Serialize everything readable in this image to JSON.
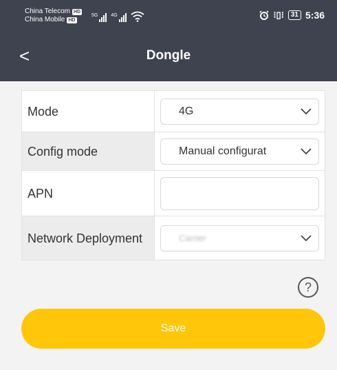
{
  "status_bar": {
    "carrier1": "China Telecom",
    "carrier2": "China Mobile",
    "hd_badge": "HD",
    "net1": "5G",
    "net2": "4G",
    "battery": "31",
    "time": "5:36"
  },
  "header": {
    "back_glyph": "<",
    "title": "Dongle"
  },
  "form": {
    "rows": [
      {
        "label": "Mode",
        "value": "4G"
      },
      {
        "label": "Config mode",
        "value": "Manual configurat"
      },
      {
        "label": "APN",
        "value": ""
      },
      {
        "label": "Network Deployment",
        "value": "Carrier"
      }
    ]
  },
  "help_glyph": "?",
  "save_label": "Save",
  "colors": {
    "header_bg": "#3f4350",
    "page_bg": "#f3f3f3",
    "save_button": "#ffc60a"
  }
}
